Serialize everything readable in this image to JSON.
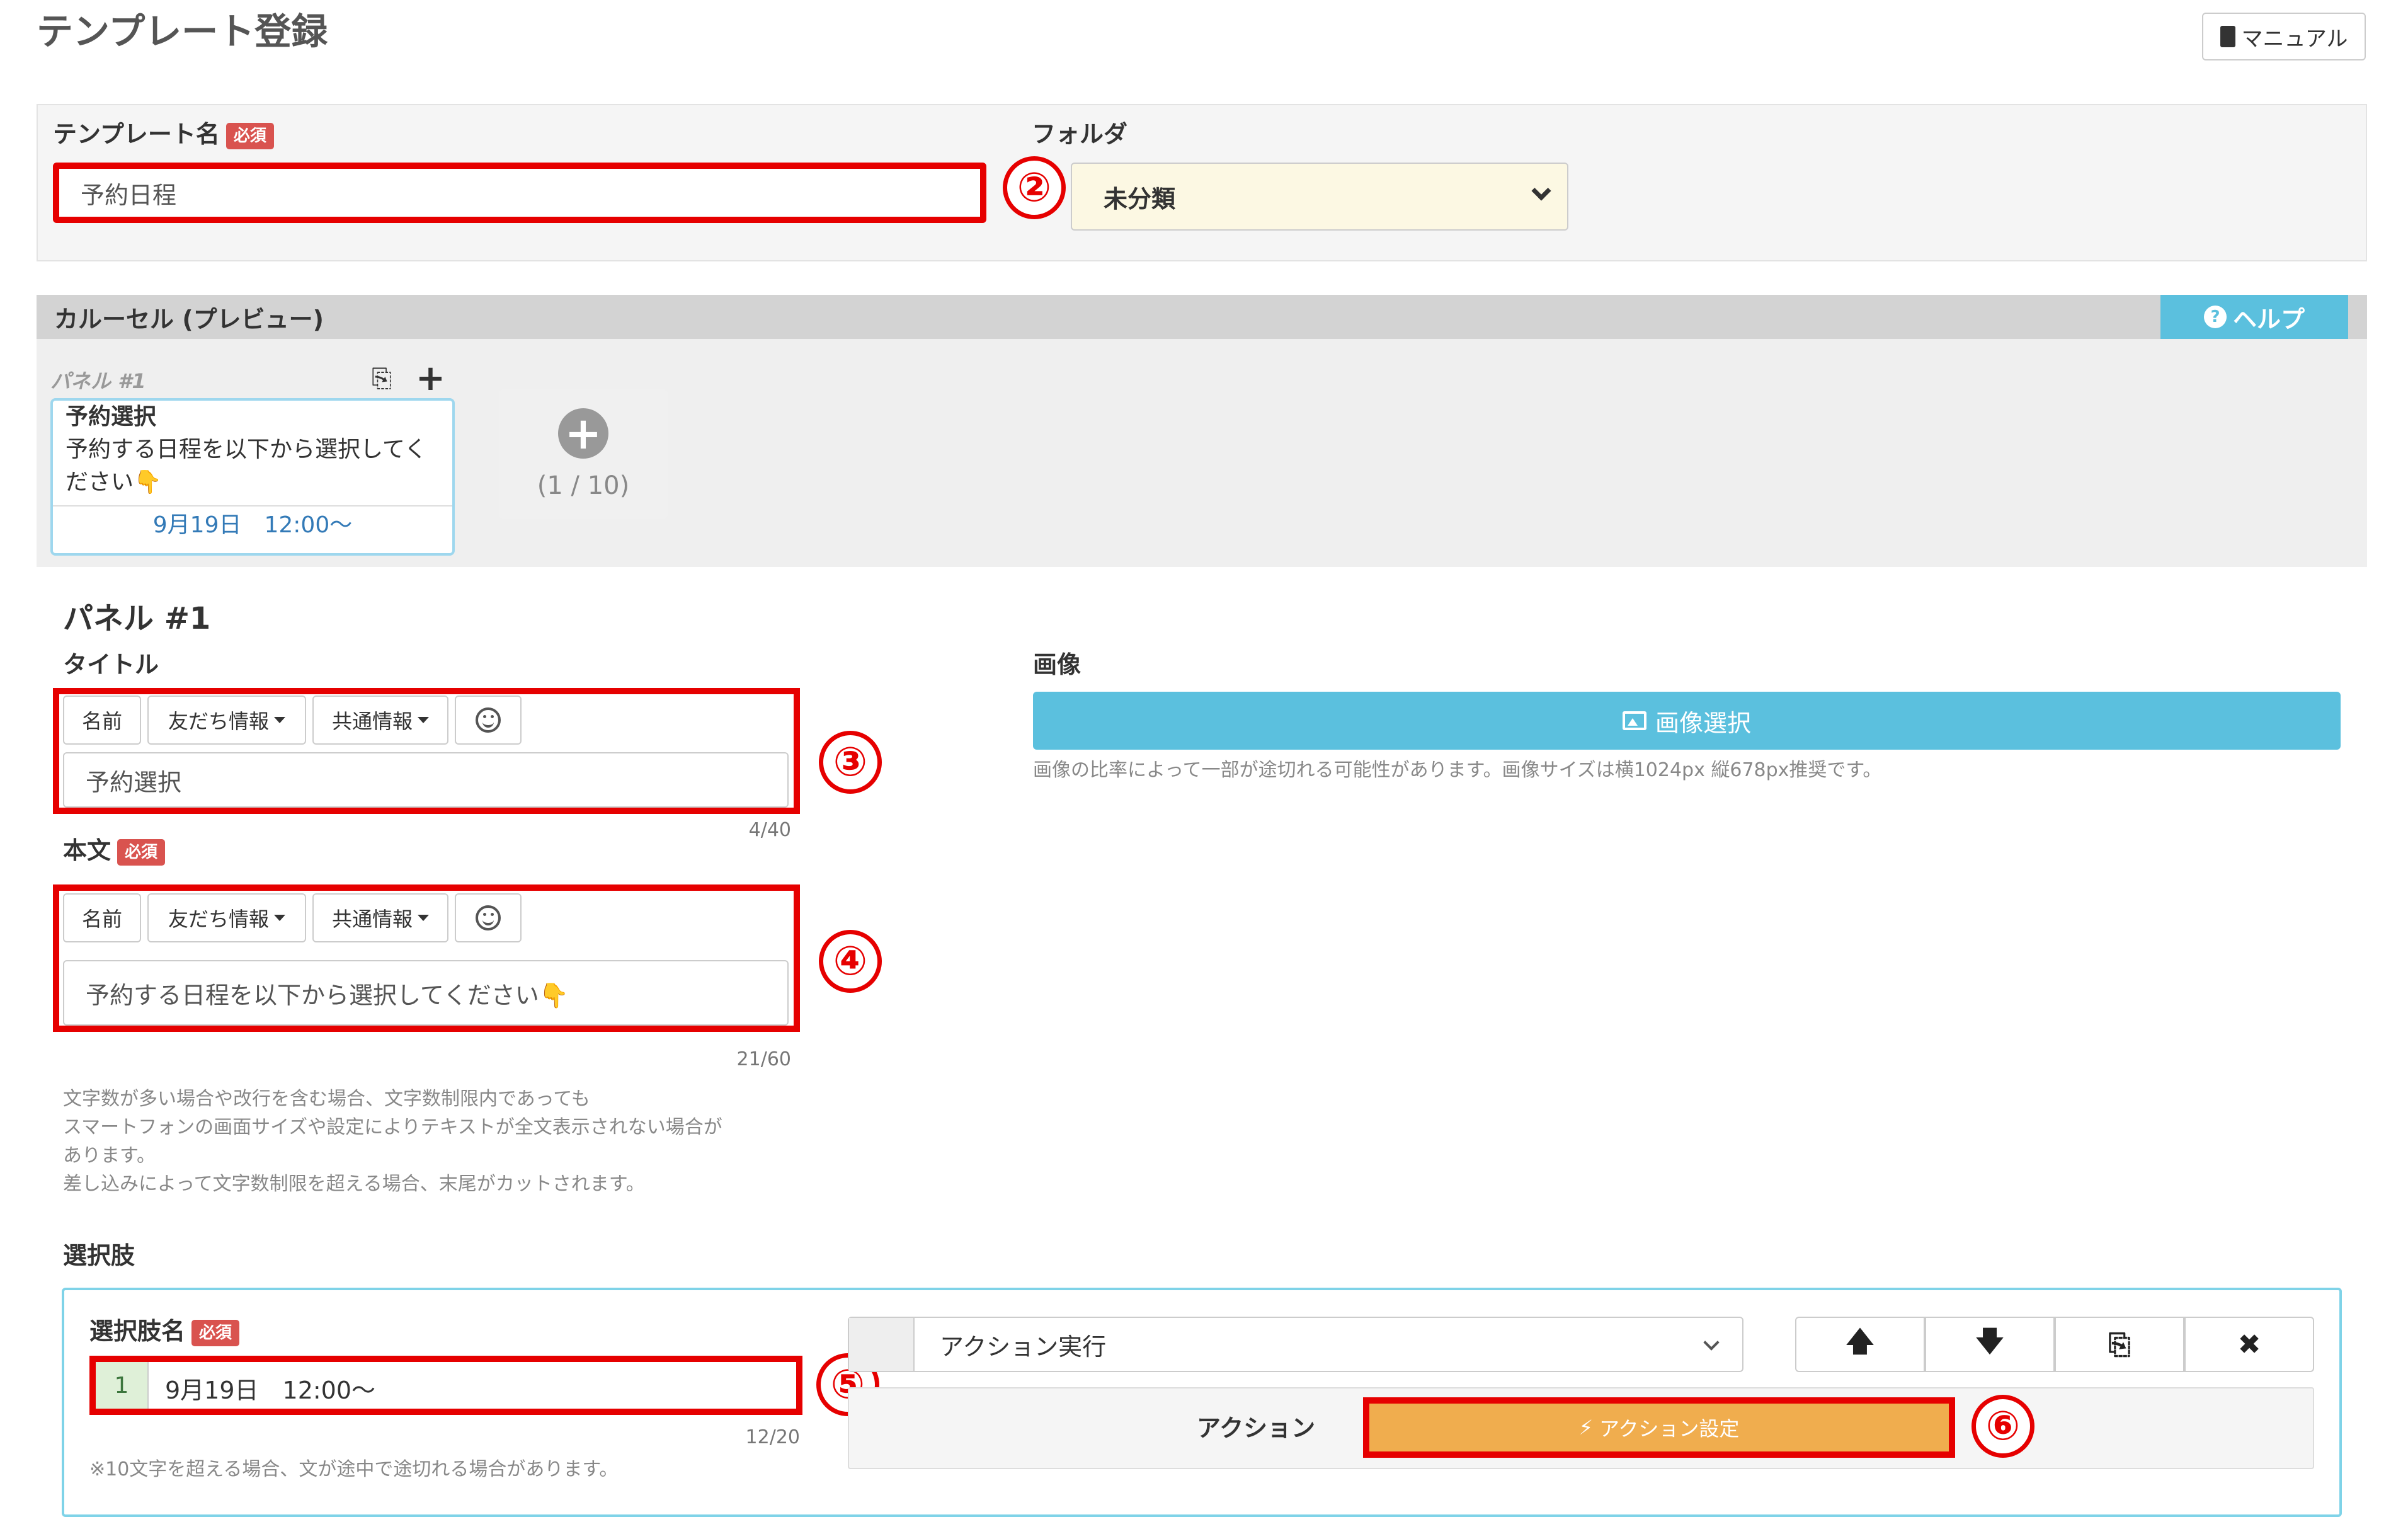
{
  "page_title": "テンプレート登録",
  "manual_button": "マニュアル",
  "template_name": {
    "label": "テンプレート名",
    "required": "必須",
    "value": "予約日程"
  },
  "folder": {
    "label": "フォルダ",
    "value": "未分類"
  },
  "carousel": {
    "header": "カルーセル (プレビュー)",
    "help": "ヘルプ",
    "panel_tab": "パネル #1",
    "card": {
      "title": "予約選択",
      "body_line1": "予約する日程を以下から選択してく",
      "body_line2": "ださい👇",
      "choice": "9月19日　12:00〜"
    },
    "add_count": "(1 / 10)"
  },
  "panel": {
    "heading": "パネル #1",
    "title_label": "タイトル",
    "toolbar": {
      "name": "名前",
      "friend": "友だち情報",
      "common": "共通情報"
    },
    "title_value": "予約選択",
    "title_count": "4/40",
    "body_label": "本文",
    "required": "必須",
    "body_value": "予約する日程を以下から選択してください👇",
    "body_count": "21/60",
    "notes": [
      "文字数が多い場合や改行を含む場合、文字数制限内であっても",
      "スマートフォンの画面サイズや設定によりテキストが全文表示されない場合が",
      "あります。",
      "差し込みによって文字数制限を超える場合、末尾がカットされます。"
    ],
    "image_label": "画像",
    "image_button": "画像選択",
    "image_note": "画像の比率によって一部が途切れる可能性があります。画像サイズは横1024px 縦678px推奨です。"
  },
  "choices": {
    "section_label": "選択肢",
    "name_label": "選択肢名",
    "required": "必須",
    "index": "1",
    "value": "9月19日　12:00〜",
    "count": "12/20",
    "note": "※10文字を超える場合、文が途中で途切れる場合があります。",
    "action_type": "アクション実行",
    "action_label": "アクション",
    "action_button": "アクション設定",
    "buttons": {
      "up": "🡅",
      "down": "🡇",
      "close": "✖"
    }
  },
  "annotations": [
    "②",
    "③",
    "④",
    "⑤",
    "⑥"
  ]
}
